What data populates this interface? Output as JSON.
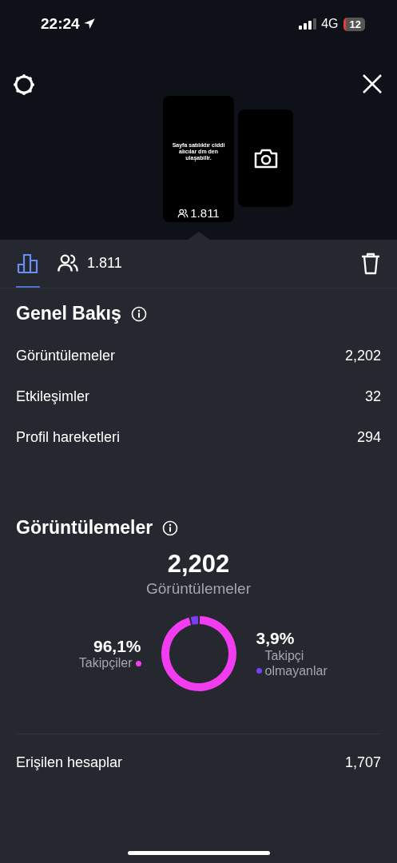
{
  "status_bar": {
    "time": "22:24",
    "network": "4G",
    "battery": "12"
  },
  "stories": [
    {
      "kind": "story",
      "text": "Sayfa satılıktır ciddi alıcılar dm den ulaşabilir.",
      "viewers": "1.811"
    },
    {
      "kind": "camera"
    }
  ],
  "tabs": [
    {
      "kind": "insights",
      "selected": true
    },
    {
      "kind": "viewers",
      "label": "1.811",
      "selected": false
    }
  ],
  "overview": {
    "title": "Genel Bakış",
    "rows": [
      {
        "label": "Görüntülemeler",
        "value": "2,202"
      },
      {
        "label": "Etkileşimler",
        "value": "32"
      },
      {
        "label": "Profil hareketleri",
        "value": "294"
      }
    ]
  },
  "views": {
    "title": "Görüntülemeler",
    "total": "2,202",
    "legend": [
      {
        "percent": "96,1%",
        "color": "#f23cf0"
      },
      {
        "percent": "3,9%",
        "color": "#7a3ff5"
      }
    ],
    "chart_data": {
      "type": "donut",
      "categories": [
        "Takipçiler",
        "Takipçi olmayanlar"
      ],
      "series": [
        {
          "name": "Görüntülemeler",
          "values": [
            96.1,
            3.9
          ]
        }
      ]
    },
    "rows": [
      {
        "label": "Erişilen hesaplar",
        "value": "1,707"
      }
    ]
  }
}
